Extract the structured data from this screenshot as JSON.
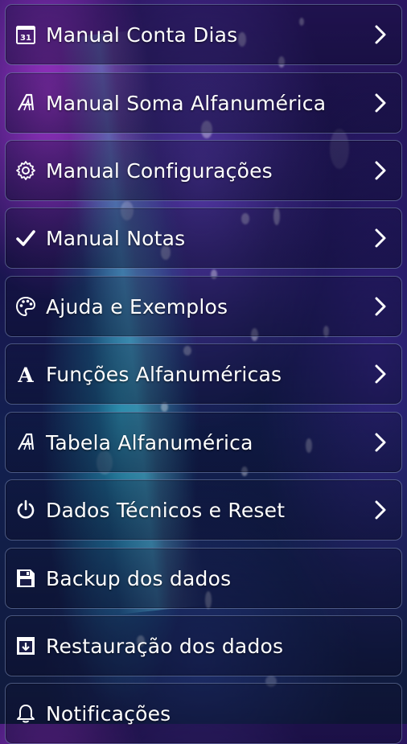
{
  "theme": {
    "text_color": "#ffffff",
    "border_color": "#96aadc"
  },
  "menu": {
    "items": [
      {
        "label": "Manual Conta Dias",
        "icon": "calendar-31-icon",
        "calendar_day": "31",
        "has_chevron": true
      },
      {
        "label": "Manual Soma Alfanumérica",
        "icon": "alpha-a-logo-icon",
        "has_chevron": true
      },
      {
        "label": "Manual Configurações",
        "icon": "gear-icon",
        "has_chevron": true
      },
      {
        "label": "Manual Notas",
        "icon": "checkmark-icon",
        "has_chevron": true
      },
      {
        "label": "Ajuda e Exemplos",
        "icon": "palette-icon",
        "has_chevron": true
      },
      {
        "label": "Funções Alfanuméricas",
        "icon": "serif-a-icon",
        "glyph": "A",
        "has_chevron": true
      },
      {
        "label": "Tabela Alfanumérica",
        "icon": "alpha-a-logo-icon",
        "has_chevron": true
      },
      {
        "label": "Dados Técnicos e Reset",
        "icon": "power-icon",
        "has_chevron": true
      },
      {
        "label": "Backup dos dados",
        "icon": "save-disk-icon",
        "has_chevron": false
      },
      {
        "label": "Restauração dos dados",
        "icon": "download-box-icon",
        "has_chevron": false
      },
      {
        "label": "Notificações",
        "icon": "bell-icon",
        "has_chevron": false
      }
    ]
  }
}
